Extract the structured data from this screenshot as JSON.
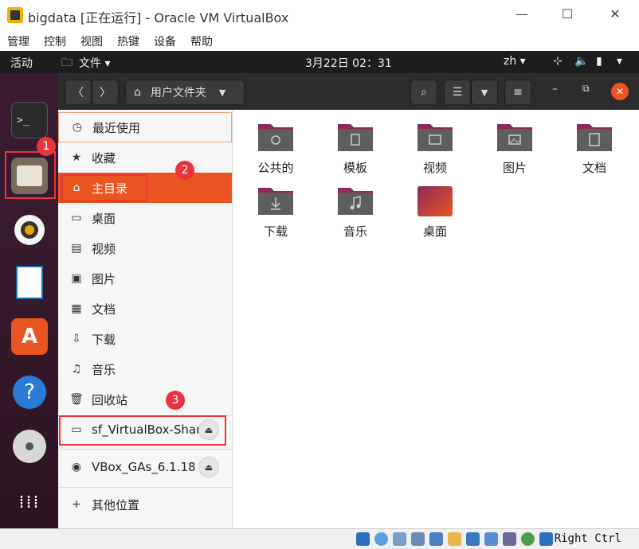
{
  "vbox": {
    "title": "bigdata [正在运行] - Oracle VM VirtualBox",
    "menu": [
      "管理",
      "控制",
      "视图",
      "热键",
      "设备",
      "帮助"
    ],
    "host_key": "Right Ctrl"
  },
  "topbar": {
    "activities": "活动",
    "app_menu": "文件 ▾",
    "clock": "3月22日  02：31",
    "lang": "zh ▾"
  },
  "headerbar": {
    "path_label": "用户文件夹"
  },
  "sidebar": {
    "recent": "最近使用",
    "starred": "收藏",
    "home": "主目录",
    "desktop": "桌面",
    "videos": "视频",
    "pictures": "图片",
    "documents": "文档",
    "downloads": "下载",
    "music": "音乐",
    "trash": "回收站",
    "share": "sf_VirtualBox-Share",
    "vbox_gas": "VBox_GAs_6.1.18",
    "other": "其他位置"
  },
  "folders": [
    {
      "label": "公共的",
      "icon": "share-icon"
    },
    {
      "label": "模板",
      "icon": "template-icon"
    },
    {
      "label": "视频",
      "icon": "video-icon"
    },
    {
      "label": "图片",
      "icon": "image-icon"
    },
    {
      "label": "文档",
      "icon": "document-icon"
    },
    {
      "label": "下载",
      "icon": "download-icon"
    },
    {
      "label": "音乐",
      "icon": "music-icon"
    },
    {
      "label": "桌面",
      "icon": "desktop-icon"
    }
  ],
  "annotations": [
    "1",
    "2",
    "3"
  ],
  "colors": {
    "accent": "#e95420",
    "annotation_red": "#e8353b",
    "folder_body": "#5e5e5e",
    "folder_tab": "#8c2a5a"
  }
}
